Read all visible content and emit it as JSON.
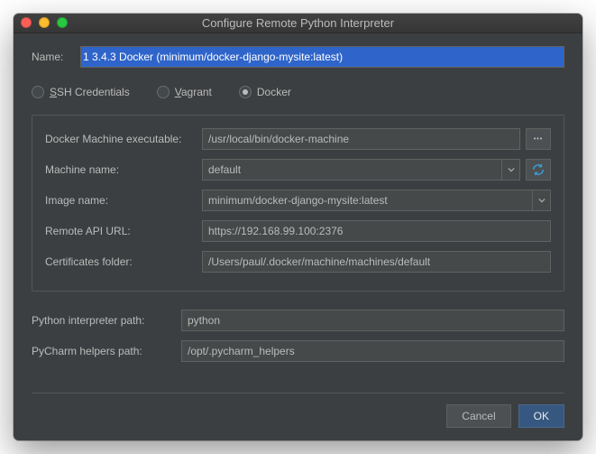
{
  "window": {
    "title": "Configure Remote Python Interpreter"
  },
  "name": {
    "label": "Name:",
    "value": "1 3.4.3 Docker (minimum/docker-django-mysite:latest)"
  },
  "modes": {
    "ssh": "SSH Credentials",
    "vagrant": "Vagrant",
    "docker": "Docker"
  },
  "docker": {
    "exec_label": "Docker Machine executable:",
    "exec_value": "/usr/local/bin/docker-machine",
    "machine_label": "Machine name:",
    "machine_value": "default",
    "image_label": "Image name:",
    "image_value": "minimum/docker-django-mysite:latest",
    "api_label": "Remote API URL:",
    "api_value": "https://192.168.99.100:2376",
    "cert_label": "Certificates folder:",
    "cert_value": "/Users/paul/.docker/machine/machines/default"
  },
  "interp": {
    "label": "Python interpreter path:",
    "value": "python"
  },
  "helpers": {
    "label": "PyCharm helpers path:",
    "value": "/opt/.pycharm_helpers"
  },
  "footer": {
    "cancel": "Cancel",
    "ok": "OK"
  }
}
